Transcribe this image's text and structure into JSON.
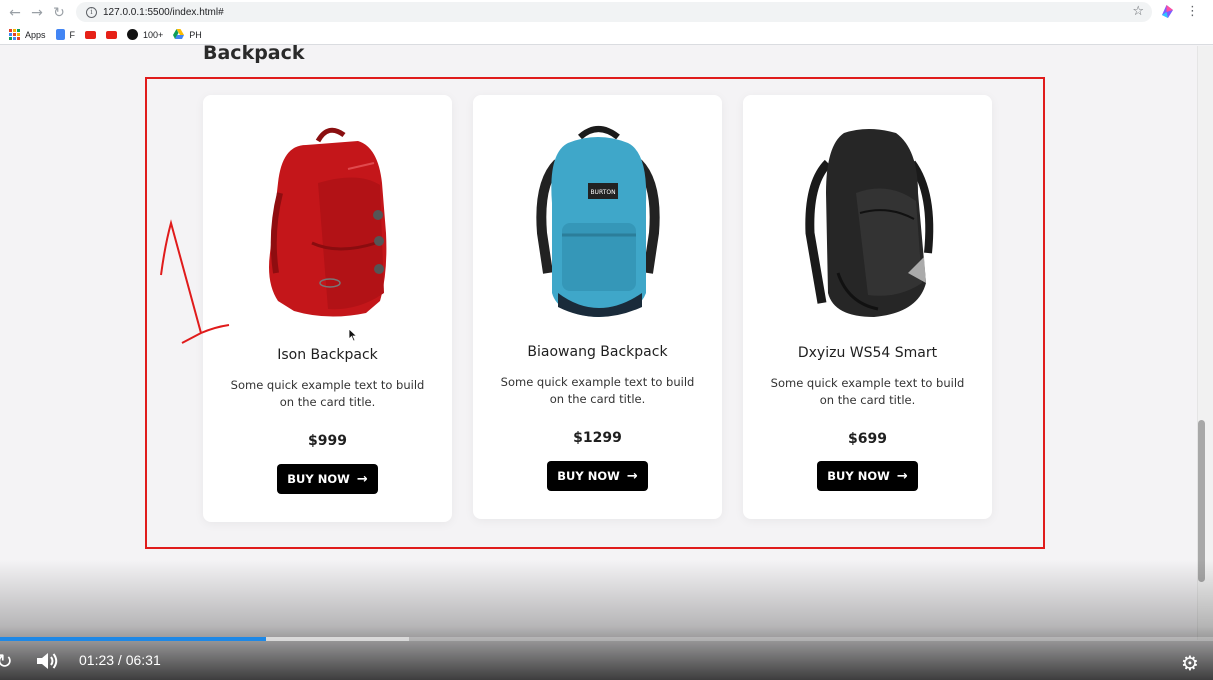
{
  "browser": {
    "url": "127.0.0.1:5500/index.html#",
    "bookmarks": [
      "Apps",
      "F",
      "",
      "",
      "100+",
      "PH"
    ]
  },
  "page": {
    "section_title": "Backpack",
    "cards": [
      {
        "title": "Ison Backpack",
        "text": "Some quick example text to build on the card title.",
        "price": "$999",
        "button": "BUY NOW",
        "image": "red-backpack"
      },
      {
        "title": "Biaowang Backpack",
        "text": "Some quick example text to build on the card title.",
        "price": "$1299",
        "button": "BUY NOW",
        "image": "blue-backpack",
        "brand_tag": "BURTON"
      },
      {
        "title": "Dxyizu WS54 Smart",
        "text": "Some quick example text to build on the card title.",
        "price": "$699",
        "button": "BUY NOW",
        "image": "black-backpack"
      }
    ]
  },
  "video": {
    "time": "01:23 / 06:31",
    "progress_fraction": 0.219
  },
  "colors": {
    "annotation": "#e01b1b",
    "progress": "#1e88e5",
    "button": "#000000"
  }
}
